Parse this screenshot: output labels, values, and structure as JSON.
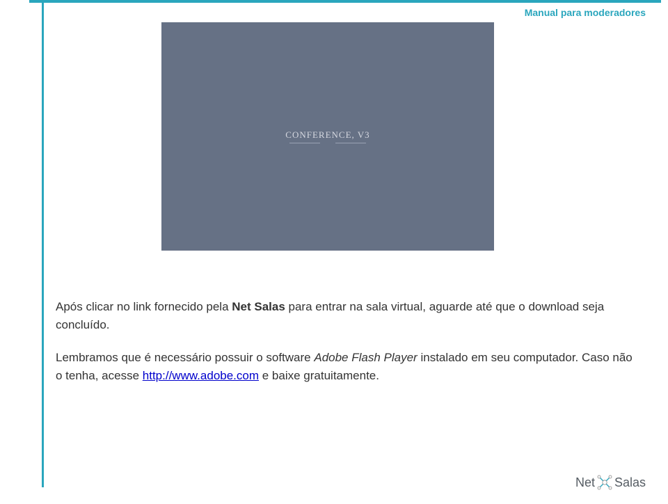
{
  "header": {
    "title": "Manual para moderadores"
  },
  "screenshot": {
    "label": "CONFERENCE, V3"
  },
  "body": {
    "p1_prefix": "Após clicar no link fornecido pela ",
    "p1_bold": "Net Salas",
    "p1_suffix": " para entrar na sala virtual, aguarde até que o download seja concluído.",
    "p2_prefix": "Lembramos que é necessário possuir o software ",
    "p2_italic": "Adobe Flash Player",
    "p2_mid": " instalado em seu computador. Caso não o tenha, acesse ",
    "p2_link": "http://www.adobe.com",
    "p2_suffix": " e baixe gratuitamente."
  },
  "logo": {
    "left": "Net",
    "right": "Salas"
  }
}
